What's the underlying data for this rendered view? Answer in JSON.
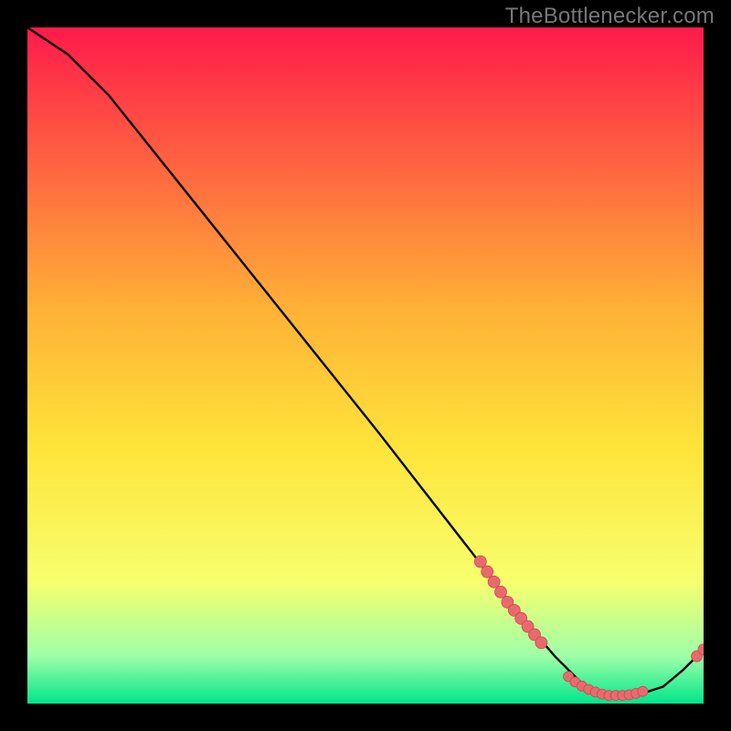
{
  "watermark": "TheBottlenecker.com",
  "colors": {
    "bg": "#000000",
    "grad_top": "#ff1a4b",
    "grad_mid1": "#ffb236",
    "grad_mid2": "#ffe43a",
    "grad_low1": "#f7ff6e",
    "grad_low2": "#9effa8",
    "grad_bottom": "#00e58a",
    "curve": "#000000",
    "dot_fill": "#e96a6e",
    "dot_stroke": "#c94b50"
  },
  "chart_data": {
    "type": "line",
    "title": "",
    "xlabel": "",
    "ylabel": "",
    "xlim": [
      0,
      100
    ],
    "ylim": [
      0,
      100
    ],
    "curve": [
      {
        "x": 0,
        "y": 100
      },
      {
        "x": 6,
        "y": 96
      },
      {
        "x": 12,
        "y": 90
      },
      {
        "x": 28,
        "y": 70
      },
      {
        "x": 52,
        "y": 40
      },
      {
        "x": 66,
        "y": 22
      },
      {
        "x": 72,
        "y": 14
      },
      {
        "x": 78,
        "y": 7
      },
      {
        "x": 82,
        "y": 3
      },
      {
        "x": 86,
        "y": 1.2
      },
      {
        "x": 90,
        "y": 1.2
      },
      {
        "x": 94,
        "y": 2.5
      },
      {
        "x": 97,
        "y": 5
      },
      {
        "x": 100,
        "y": 8
      }
    ],
    "dots_segment": [
      {
        "x": 67,
        "y": 21
      },
      {
        "x": 68,
        "y": 19.5
      },
      {
        "x": 69,
        "y": 18
      },
      {
        "x": 70,
        "y": 16.5
      },
      {
        "x": 71,
        "y": 15
      },
      {
        "x": 72,
        "y": 13.8
      },
      {
        "x": 73,
        "y": 12.6
      },
      {
        "x": 74,
        "y": 11.4
      },
      {
        "x": 75,
        "y": 10.2
      },
      {
        "x": 76,
        "y": 9.0
      }
    ],
    "dots_trough": [
      {
        "x": 80,
        "y": 4.0
      },
      {
        "x": 81,
        "y": 3.2
      },
      {
        "x": 82,
        "y": 2.6
      },
      {
        "x": 83,
        "y": 2.1
      },
      {
        "x": 84,
        "y": 1.7
      },
      {
        "x": 85,
        "y": 1.4
      },
      {
        "x": 86,
        "y": 1.2
      },
      {
        "x": 87,
        "y": 1.2
      },
      {
        "x": 88,
        "y": 1.2
      },
      {
        "x": 89,
        "y": 1.3
      },
      {
        "x": 90,
        "y": 1.5
      },
      {
        "x": 91,
        "y": 1.8
      }
    ],
    "dots_tail": [
      {
        "x": 99,
        "y": 7
      },
      {
        "x": 100,
        "y": 8
      }
    ]
  }
}
